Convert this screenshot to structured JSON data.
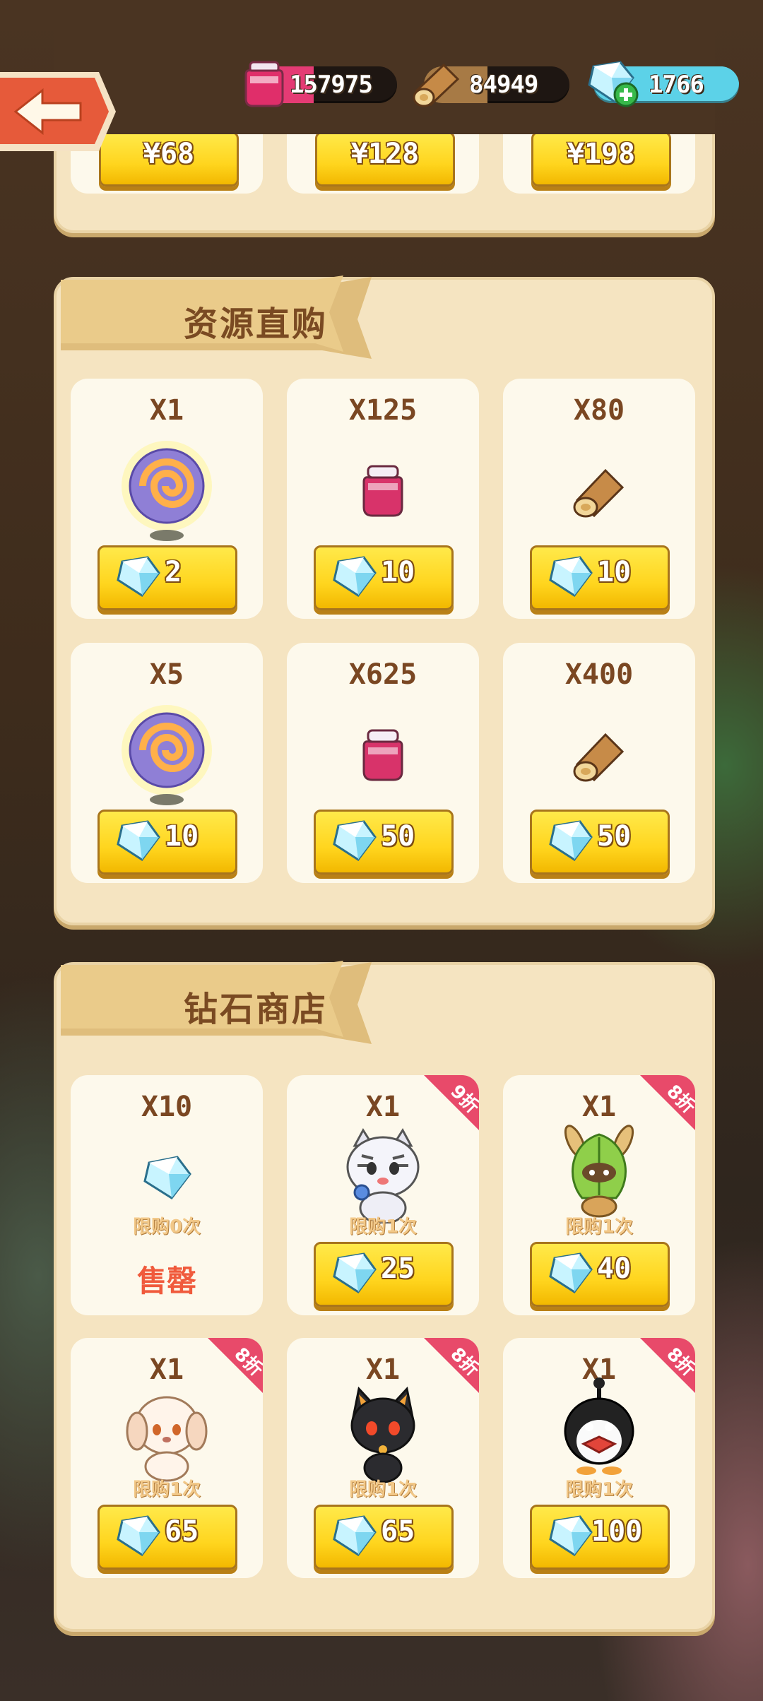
{
  "resources": {
    "potion": "157975",
    "wood": "84949",
    "diamond": "1766"
  },
  "top_prices": [
    "¥68",
    "¥128",
    "¥198"
  ],
  "sections": {
    "resources": {
      "title": "资源直购",
      "items": [
        {
          "qty": "X1",
          "icon": "swirl-orb-icon",
          "price": "2"
        },
        {
          "qty": "X125",
          "icon": "potion-jar-icon",
          "price": "10"
        },
        {
          "qty": "X80",
          "icon": "wood-log-icon",
          "price": "10"
        },
        {
          "qty": "X5",
          "icon": "swirl-orb-icon",
          "price": "10"
        },
        {
          "qty": "X625",
          "icon": "potion-jar-icon",
          "price": "50"
        },
        {
          "qty": "X400",
          "icon": "wood-log-icon",
          "price": "50"
        }
      ]
    },
    "diamond_shop": {
      "title": "钻石商店",
      "items": [
        {
          "qty": "X10",
          "icon": "diamond-icon",
          "limit": "限购0次",
          "soldout": "售罄",
          "discount": ""
        },
        {
          "qty": "X1",
          "icon": "white-tiger-icon",
          "limit": "限购1次",
          "price": "25",
          "discount": "9折"
        },
        {
          "qty": "X1",
          "icon": "leaf-bunny-icon",
          "limit": "限购1次",
          "price": "40",
          "discount": "8折"
        },
        {
          "qty": "X1",
          "icon": "cream-puppy-icon",
          "limit": "限购1次",
          "price": "65",
          "discount": "8折"
        },
        {
          "qty": "X1",
          "icon": "black-cat-icon",
          "limit": "限购1次",
          "price": "65",
          "discount": "8折"
        },
        {
          "qty": "X1",
          "icon": "penguin-icon",
          "limit": "限购1次",
          "price": "100",
          "discount": "8折"
        }
      ]
    }
  },
  "colors": {
    "panel": "#f5e4c1",
    "card": "#fdf9ec",
    "button": "#ffd51e",
    "text_brown": "#7a4722",
    "soldout_red": "#f05a3c",
    "ribbon_pink": "#e84a6a"
  }
}
